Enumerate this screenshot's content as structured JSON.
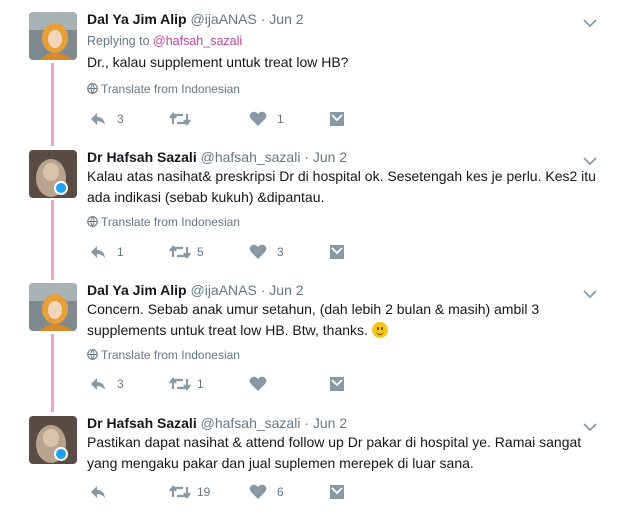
{
  "tweets": [
    {
      "name": "Dal Ya Jim Alip",
      "handle": "@ijaANAS",
      "dot": "·",
      "date": "Jun 2",
      "replying_prefix": "Replying to",
      "replying_to": "@hafsah_sazali",
      "text": "Dr., kalau supplement untuk treat low HB?",
      "translate": "Translate from Indonesian",
      "replies": "3",
      "retweets": "",
      "likes": "1"
    },
    {
      "name": "Dr Hafsah Sazali",
      "handle": "@hafsah_sazali",
      "dot": "·",
      "date": "Jun 2",
      "text": "Kalau atas nasihat& preskripsi Dr di hospital ok. Sesetengah kes je perlu. Kes2 itu ada indikasi (sebab kukuh) &dipantau.",
      "translate": "Translate from Indonesian",
      "replies": "1",
      "retweets": "5",
      "likes": "3"
    },
    {
      "name": "Dal Ya Jim Alip",
      "handle": "@ijaANAS",
      "dot": "·",
      "date": "Jun 2",
      "text": "Concern. Sebab anak umur setahun, (dah lebih 2 bulan & masih) ambil 3 supplements untuk treat low HB. Btw, thanks.",
      "translate": "Translate from Indonesian",
      "replies": "3",
      "retweets": "1",
      "likes": ""
    },
    {
      "name": "Dr Hafsah Sazali",
      "handle": "@hafsah_sazali",
      "dot": "·",
      "date": "Jun 2",
      "text": "Pastikan dapat nasihat & attend follow up Dr pakar di hospital ye. Ramai sangat yang mengaku pakar dan jual suplemen merepek di luar sana.",
      "replies": "",
      "retweets": "19",
      "likes": "6"
    }
  ],
  "icons": {
    "reply": "reply-icon",
    "retweet": "retweet-icon",
    "like": "heart-icon",
    "dm": "envelope-icon",
    "caret": "chevron-down-icon",
    "globe": "globe-icon",
    "emoji": "slightly-smiling-face-emoji"
  },
  "colors": {
    "thread_line": "#f2a2c9",
    "mention": "#c0449a",
    "secondary_text": "#657786",
    "action_icon": "#8899a6"
  }
}
